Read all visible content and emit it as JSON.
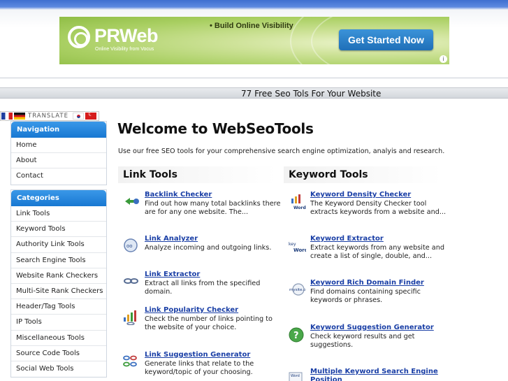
{
  "ad": {
    "brand": "PRWeb",
    "brand_tagline": "Online Visibility from Vocus",
    "headline_prefix": "• Build ",
    "headline_bold": "Online Visibility",
    "cta_label": "Get Started Now",
    "info_icon": "i"
  },
  "tagline": "77 Free Seo Tols For Your Website",
  "translate": {
    "label": "TRANSLATE",
    "flags": [
      "french-flag",
      "german-flag",
      "korean-flag",
      "turkish-flag"
    ]
  },
  "sidebar": {
    "navigation": {
      "title": "Navigation",
      "items": [
        "Home",
        "About",
        "Contact"
      ]
    },
    "categories": {
      "title": "Categories",
      "items": [
        "Link Tools",
        "Keyword Tools",
        "Authority Link Tools",
        "Search Engine Tools",
        "Website Rank Checkers",
        "Multi-Site Rank Checkers",
        "Header/Tag Tools",
        "IP Tools",
        "Miscellaneous Tools",
        "Source Code Tools",
        "Social Web Tools"
      ]
    }
  },
  "main": {
    "title": "Welcome to WebSeoTools",
    "intro": "Use our free SEO tools for your comprehensive search engine optimization, analyis and research.",
    "link_tools": {
      "heading": "Link Tools",
      "tools": [
        {
          "name": "Backlink Checker",
          "desc": "Find out how many total backlinks there are for any one website. The..."
        },
        {
          "name": "Link Analyzer",
          "desc": "Analyze incoming and outgoing links."
        },
        {
          "name": "Link Extractor",
          "desc": "Extract all links from the specified domain."
        },
        {
          "name": "Link Popularity Checker",
          "desc": "Check the number of links pointing to the website of your choice."
        },
        {
          "name": "Link Suggestion Generator",
          "desc": "Generate links that relate to the keyword/topic of your choosing."
        }
      ]
    },
    "keyword_tools": {
      "heading": "Keyword Tools",
      "tools": [
        {
          "name": "Keyword Density Checker",
          "desc": "The Keyword Density Checker tool extracts keywords from a website and..."
        },
        {
          "name": "Keyword Extractor",
          "desc": "Extract keywords from any website and create a list of single, double, and..."
        },
        {
          "name": "Keyword Rich Domain Finder",
          "desc": "Find domains containing specific keywords or phrases."
        },
        {
          "name": "Keyword Suggestion Generator",
          "desc": "Check keyword results and get suggestions."
        },
        {
          "name": "Multiple Keyword Search Engine Position",
          "desc": ""
        }
      ]
    }
  },
  "colors": {
    "accent": "#1a78d2",
    "link": "#1a3fa6",
    "ad_green": "#a9cf62",
    "cta_blue": "#2a80c8"
  }
}
